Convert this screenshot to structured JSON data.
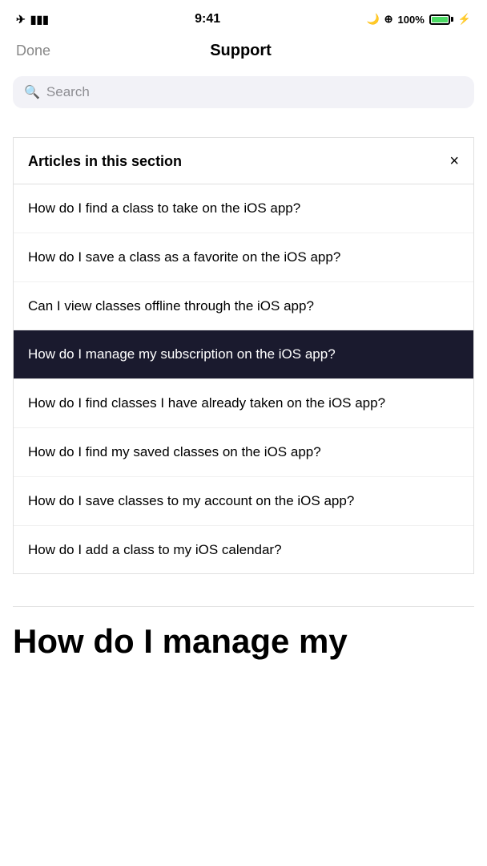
{
  "status_bar": {
    "time": "9:41",
    "battery_percent": "100%"
  },
  "nav": {
    "done_label": "Done",
    "title": "Support"
  },
  "search": {
    "placeholder": "Search"
  },
  "articles_section": {
    "heading": "Articles in this section",
    "close_icon": "×",
    "items": [
      {
        "id": 0,
        "text": "How do I find a class to take on the iOS app?",
        "active": false
      },
      {
        "id": 1,
        "text": "How do I save a class as a favorite on the iOS app?",
        "active": false
      },
      {
        "id": 2,
        "text": "Can I view classes offline through the iOS app?",
        "active": false
      },
      {
        "id": 3,
        "text": "How do I manage my subscription on the iOS app?",
        "active": true
      },
      {
        "id": 4,
        "text": "How do I find classes I have already taken on the iOS app?",
        "active": false
      },
      {
        "id": 5,
        "text": "How do I find my saved classes on the iOS app?",
        "active": false
      },
      {
        "id": 6,
        "text": "How do I save classes to my account on the iOS app?",
        "active": false
      },
      {
        "id": 7,
        "text": "How do I add a class to my iOS calendar?",
        "active": false
      }
    ]
  },
  "bottom_title": "How do I manage my"
}
